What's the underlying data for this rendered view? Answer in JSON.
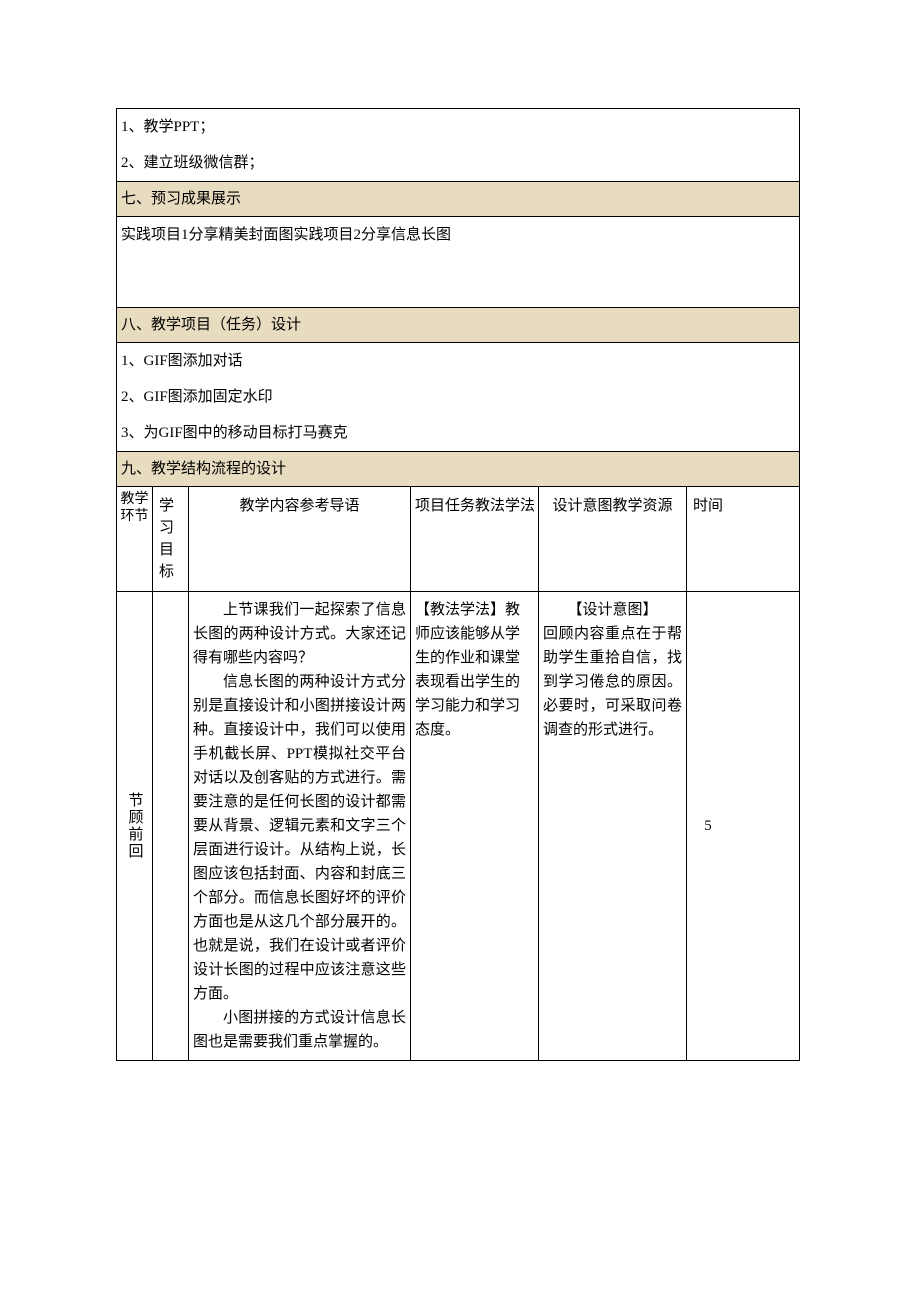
{
  "s6": {
    "items": [
      "1、教学PPT；",
      "2、建立班级微信群；"
    ]
  },
  "s7": {
    "header": "七、预习成果展示",
    "body": "实践项目1分享精美封面图实践项目2分享信息长图"
  },
  "s8": {
    "header": "八、教学项目（任务）设计",
    "items": [
      "1、GIF图添加对话",
      "2、GIF图添加固定水印",
      "3、为GIF图中的移动目标打马赛克"
    ]
  },
  "s9": {
    "header": "九、教学结构流程的设计"
  },
  "theaders": {
    "c1": "教学环节",
    "c2a": "学习",
    "c2b": "目标",
    "c3": "教学内容参考导语",
    "c4": "项目任务教法学法",
    "c5": "设计意图教学资源",
    "c6": "时间"
  },
  "row": {
    "label": "节顾前回",
    "goal": "",
    "content": {
      "p1": "上节课我们一起探索了信息长图的两种设计方式。大家还记得有哪些内容吗？",
      "p2": "信息长图的两种设计方式分别是直接设计和小图拼接设计两种。直接设计中，我们可以使用手机截长屏、PPT模拟社交平台对话以及创客贴的方式进行。需要注意的是任何长图的设计都需要从背景、逻辑元素和文字三个层面进行设计。从结构上说，长图应该包括封面、内容和封底三个部分。而信息长图好坏的评价方面也是从这几个部分展开的。也就是说，我们在设计或者评价设计长图的过程中应该注意这些方面。",
      "p3": "小图拼接的方式设计信息长图也是需要我们重点掌握的。"
    },
    "method": "【教法学法】教师应该能够从学生的作业和课堂表现看出学生的学习能力和学习态度。",
    "intentLabel": "【设计意图】",
    "intent": "回顾内容重点在于帮助学生重拾自信，找到学习倦怠的原因。必要时，可采取问卷调查的形式进行。",
    "time": "5"
  }
}
